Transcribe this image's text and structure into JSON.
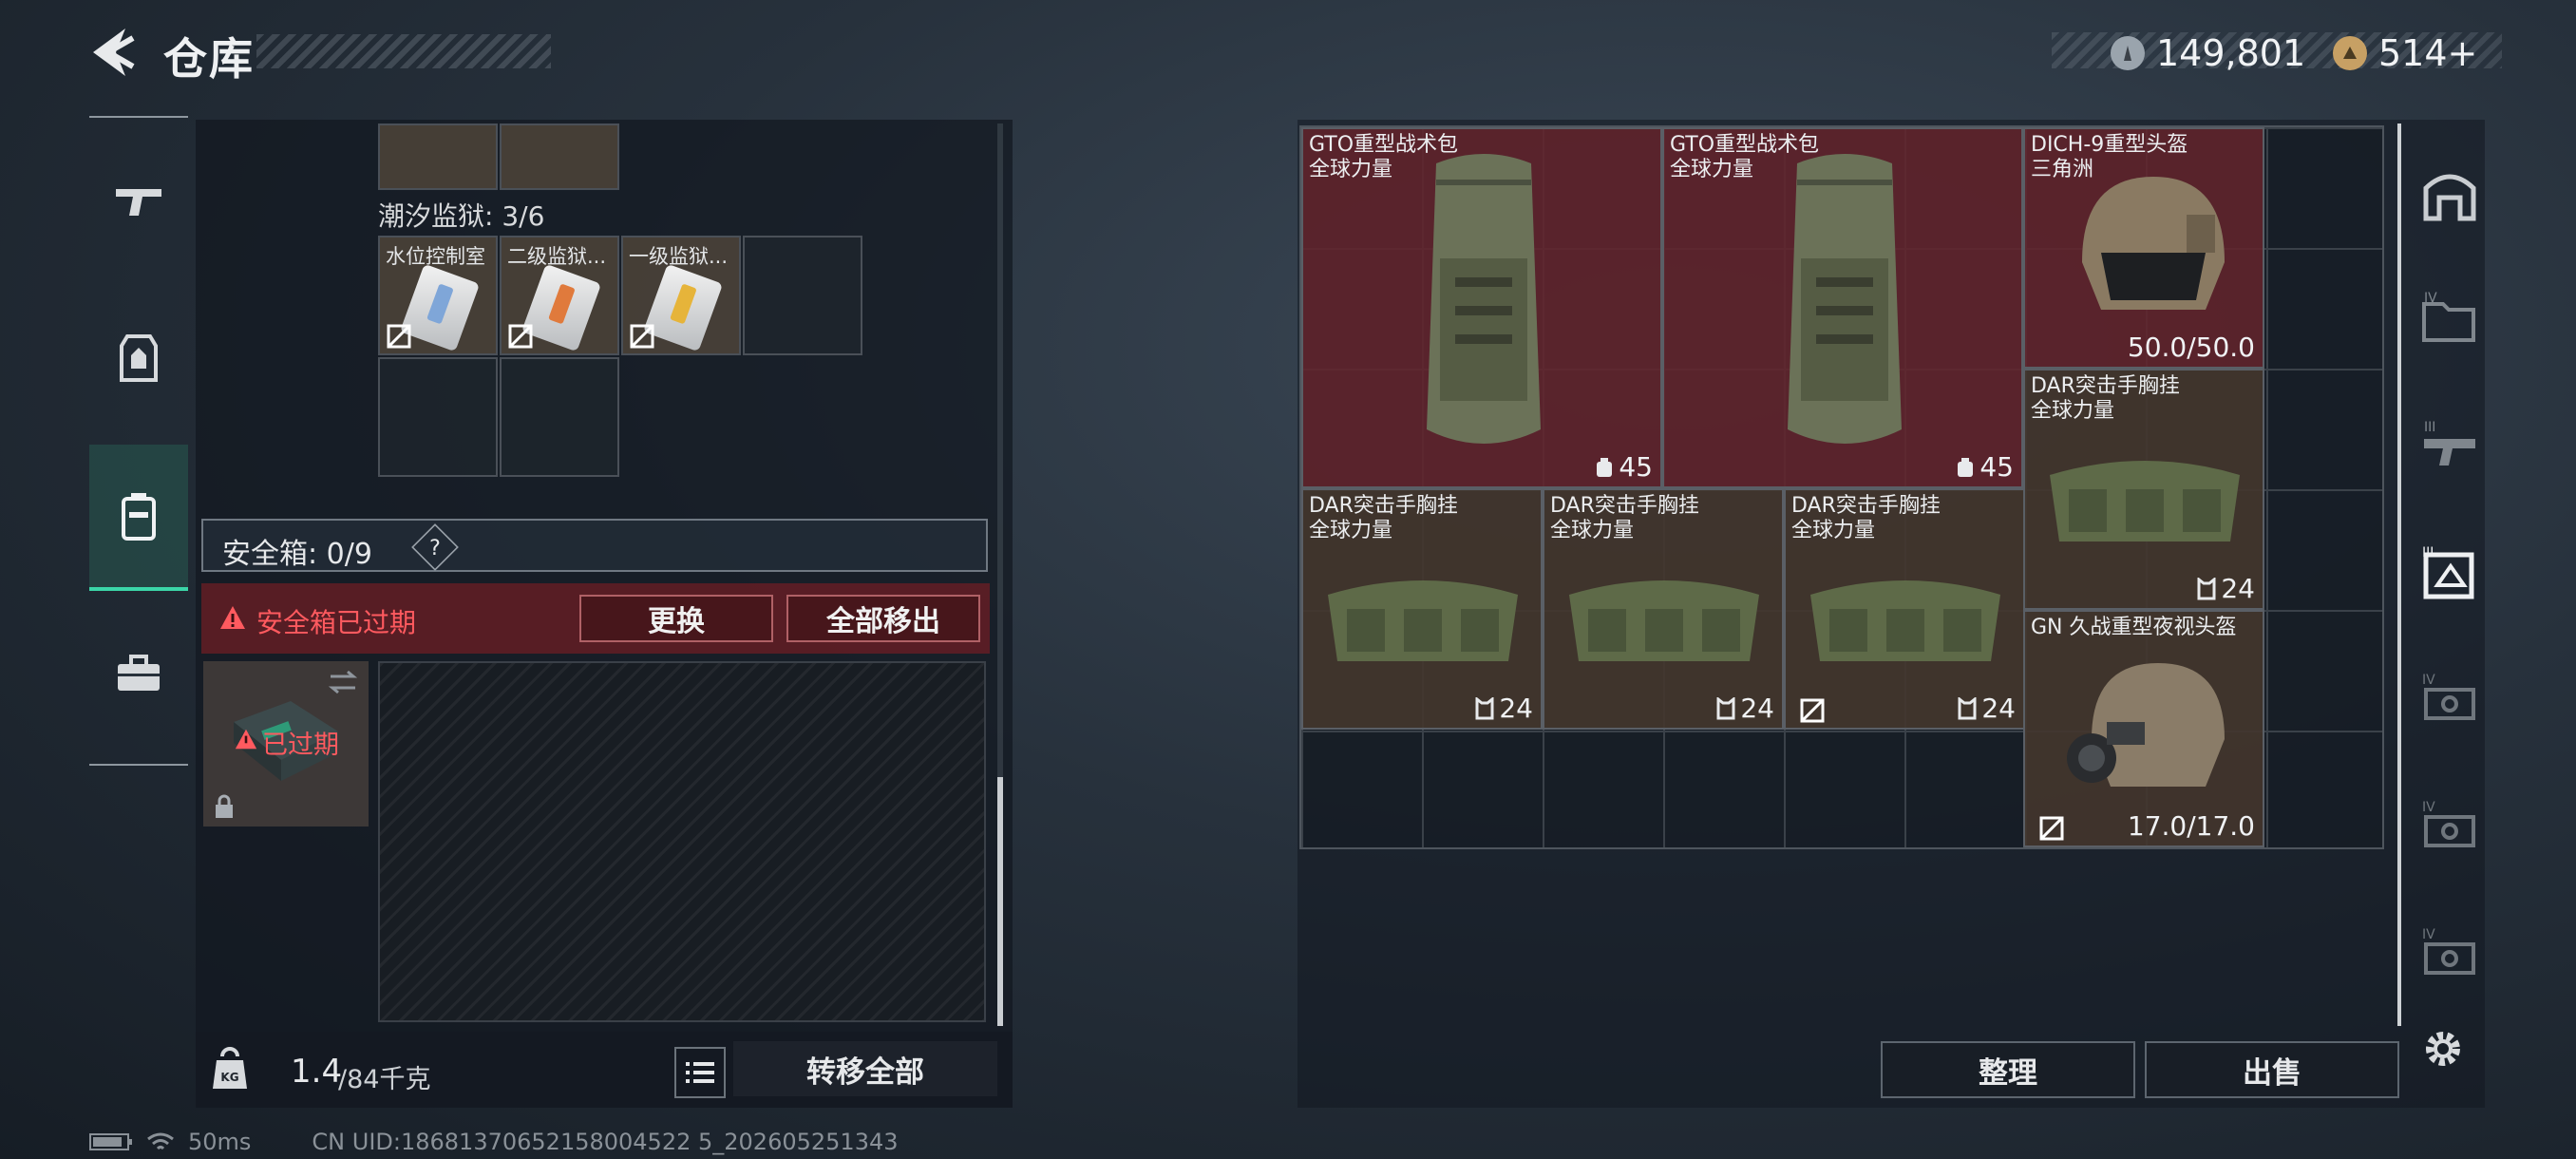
{
  "header": {
    "title": "仓库"
  },
  "currency": {
    "silver": "149,801",
    "gold": "514+",
    "colors": {
      "silver": "#9aa4ad",
      "gold": "#c7a064"
    }
  },
  "left": {
    "prison_title": "潮汐监狱: 3/6",
    "cards": [
      {
        "label": "水位控制室",
        "strip": "#7fa6d8"
      },
      {
        "label": "二级监狱...",
        "strip": "#e07a3c"
      },
      {
        "label": "一级监狱...",
        "strip": "#e6b43a"
      }
    ],
    "safe_box": {
      "label": "安全箱: 0/9",
      "help": "?"
    },
    "expired": {
      "warning": "安全箱已过期",
      "replace": "更换",
      "remove_all": "全部移出",
      "case_label": "已过期"
    },
    "footer": {
      "weight": "1.4",
      "capacity": "/84千克",
      "transfer_all": "转移全部"
    }
  },
  "right": {
    "items": [
      {
        "name1": "GTO重型战术包",
        "name2": "全球力量",
        "value": "45"
      },
      {
        "name1": "GTO重型战术包",
        "name2": "全球力量",
        "value": "45"
      },
      {
        "name1": "DICH-9重型头盔",
        "name2": "三角洲",
        "value": "50.0/50.0"
      },
      {
        "name1": "DAR突击手胸挂",
        "name2": "全球力量",
        "value": "24"
      },
      {
        "name1": "DAR突击手胸挂",
        "name2": "全球力量",
        "value": "24"
      },
      {
        "name1": "DAR突击手胸挂",
        "name2": "全球力量",
        "value": "24"
      },
      {
        "name1": "DAR突击手胸挂",
        "name2": "全球力量",
        "value": "24"
      },
      {
        "name1": "GN 久战重型夜视头盔",
        "name2": "",
        "value": "17.0/17.0"
      }
    ],
    "sort": "整理",
    "sell": "出售"
  },
  "status": {
    "ping": "50ms",
    "uid": "CN UID:18681370652158004522 5_202605251343"
  },
  "colors": {
    "accent": "#3bd6a8",
    "alert": "#e5484d",
    "red_item": "#62242c",
    "brown_item": "#44362e"
  }
}
